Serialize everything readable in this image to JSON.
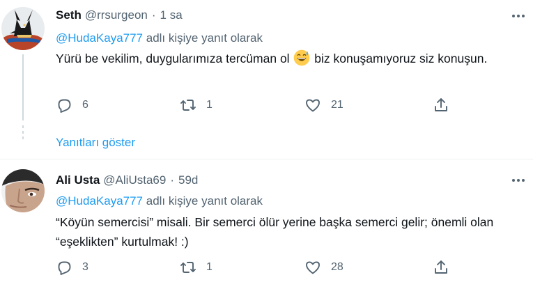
{
  "tweets": [
    {
      "display_name": "Seth",
      "handle": "@rrsurgeon",
      "separator": "·",
      "time": "1 sa",
      "reply_mention": "@HudaKaya777",
      "reply_suffix": "adlı kişiye yanıt olarak",
      "text_before_emoji": "Yürü be vekilim, duygularımıza tercüman ol ",
      "emoji": "grinning-face-with-sweat",
      "text_after_emoji": " biz konuşamıyoruz siz konuşun.",
      "replies": "6",
      "retweets": "1",
      "likes": "21",
      "show_replies": "Yanıtları göster"
    },
    {
      "display_name": "Ali Usta",
      "handle": "@AliUsta69",
      "separator": "·",
      "time": "59d",
      "reply_mention": "@HudaKaya777",
      "reply_suffix": "adlı kişiye yanıt olarak",
      "text": "“Köyün semercisi” misali. Bir semerci ölür yerine başka semerci gelir; önemli olan “eşeklikten” kurtulmak! :)",
      "replies": "3",
      "retweets": "1",
      "likes": "28"
    }
  ],
  "colors": {
    "link": "#1d9bf0",
    "secondary_text": "#536471",
    "primary_text": "#0f1419",
    "divider": "#eff3f4"
  }
}
